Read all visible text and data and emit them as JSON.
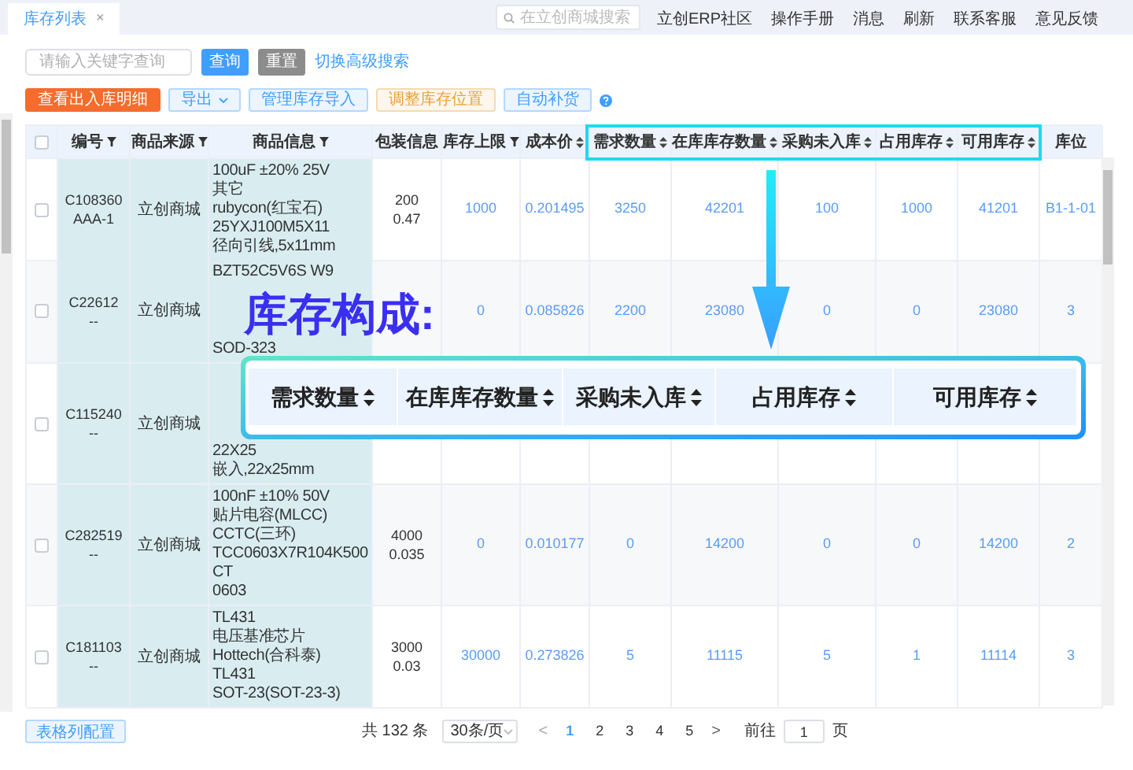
{
  "tabs": [
    {
      "label": "库存列表",
      "close": "×",
      "selected": true
    }
  ],
  "top_search": {
    "placeholder": "在立创商城搜索"
  },
  "top_links": [
    "立创ERP社区",
    "操作手册",
    "消息",
    "刷新",
    "联系客服",
    "意见反馈"
  ],
  "search": {
    "placeholder": "请输入关键字查询",
    "buttons": [
      {
        "label": "查询",
        "kind": "primary"
      },
      {
        "label": "重置",
        "kind": "gray"
      }
    ],
    "link": "切换高级搜索"
  },
  "toolbar": [
    {
      "label": "查看出入库明细",
      "kind": "orange"
    },
    {
      "label": "导出",
      "kind": "dropdown"
    },
    {
      "label": "管理库存导入",
      "kind": "blue"
    },
    {
      "label": "调整库存位置",
      "kind": "amber"
    },
    {
      "label": "自动补货",
      "kind": "blue"
    }
  ],
  "table": {
    "header_checkbox": {
      "checked": false
    },
    "columns": [
      {
        "label": "编号",
        "filterable": true,
        "sortable": false
      },
      {
        "label": "商品来源",
        "filterable": true,
        "sortable": false
      },
      {
        "label": "商品信息",
        "filterable": true,
        "sortable": false
      },
      {
        "label": "包装信息",
        "filterable": false,
        "sortable": false
      },
      {
        "label": "库存上限",
        "filterable": true,
        "sortable": false
      },
      {
        "label": "成本价",
        "filterable": false,
        "sortable": true
      },
      {
        "label": "需求数量",
        "filterable": false,
        "sortable": true
      },
      {
        "label": "在库库存数量",
        "filterable": false,
        "sortable": true
      },
      {
        "label": "采购未入库",
        "filterable": false,
        "sortable": true
      },
      {
        "label": "占用库存",
        "filterable": false,
        "sortable": true
      },
      {
        "label": "可用库存",
        "filterable": false,
        "sortable": true
      },
      {
        "label": "库位",
        "filterable": false,
        "sortable": false
      }
    ],
    "rows": [
      {
        "checked": false,
        "code": [
          "C108360",
          "AAA-1"
        ],
        "source": "立创商城",
        "info": [
          "100uF ±20% 25V",
          "其它",
          "rubycon(红宝石)",
          "25YXJ100M5X11",
          "径向引线,5x11mm"
        ],
        "package": [
          "200",
          "0.47"
        ],
        "max": "1000",
        "cost": "0.201495",
        "demand": "3250",
        "in_stock": "42201",
        "on_order": "100",
        "reserved": "1000",
        "available": "41201",
        "location": "B1-1-01"
      },
      {
        "checked": false,
        "code": [
          "C22612",
          "--"
        ],
        "source": "立创商城",
        "info": [
          "BZT52C5V6S W9",
          "SOD-323"
        ],
        "max": "0",
        "cost": "0.085826",
        "demand": "2200",
        "in_stock": "23080",
        "on_order": "0",
        "reserved": "0",
        "available": "23080",
        "location": "3"
      },
      {
        "checked": false,
        "code": [
          "C115240",
          "--"
        ],
        "source": "立创商城",
        "info": [
          "22X25",
          "嵌入,22x25mm"
        ]
      },
      {
        "checked": false,
        "code": [
          "C282519",
          "--"
        ],
        "source": "立创商城",
        "info": [
          "100nF ±10% 50V",
          "贴片电容(MLCC)",
          "CCTC(三环)",
          "TCC0603X7R104K500",
          "CT",
          "0603"
        ],
        "package": [
          "4000",
          "0.035"
        ],
        "max": "0",
        "cost": "0.010177",
        "demand": "0",
        "in_stock": "14200",
        "on_order": "0",
        "reserved": "0",
        "available": "14200",
        "location": "2"
      },
      {
        "checked": false,
        "code": [
          "C181103",
          "--"
        ],
        "source": "立创商城",
        "info": [
          "TL431",
          "电压基准芯片",
          "Hottech(合科泰)",
          "TL431",
          "SOT-23(SOT-23-3)"
        ],
        "package": [
          "3000",
          "0.03"
        ],
        "max": "30000",
        "cost": "0.273826",
        "demand": "5",
        "in_stock": "11115",
        "on_order": "5",
        "reserved": "1",
        "available": "11114",
        "location": "3"
      }
    ]
  },
  "annotation": {
    "title": "库存构成:",
    "columns": [
      "需求数量",
      "在库库存数量",
      "采购未入库",
      "占用库存",
      "可用库存"
    ]
  },
  "footer": {
    "config_button": "表格列配置",
    "total": "共 132 条",
    "page_size": "30条/页",
    "prev": "<",
    "next": ">",
    "pages": [
      {
        "label": "1",
        "selected": true
      },
      {
        "label": "2",
        "selected": false
      },
      {
        "label": "3",
        "selected": false
      },
      {
        "label": "4",
        "selected": false
      },
      {
        "label": "5",
        "selected": false
      }
    ],
    "goto_label": "前往",
    "goto_value": "1",
    "goto_suffix": "页"
  }
}
